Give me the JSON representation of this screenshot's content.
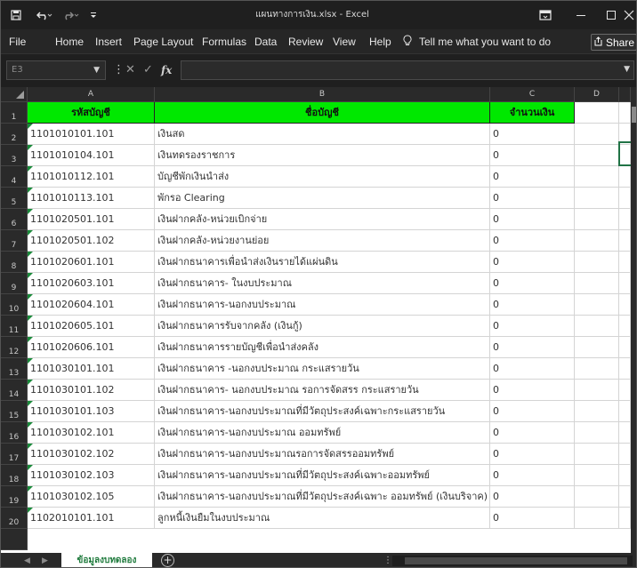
{
  "window": {
    "title": "แผนทางการเงิน.xlsx - Excel",
    "controls": [
      "minimize",
      "restore",
      "close"
    ]
  },
  "quick_access": {
    "save_icon": "save-icon",
    "undo_icon": "undo-icon",
    "redo_icon": "redo-icon"
  },
  "menu": {
    "items": [
      "File",
      "Home",
      "Insert",
      "Page Layout",
      "Formulas",
      "Data",
      "Review",
      "View",
      "Help"
    ],
    "tell_me": "Tell me what you want to do",
    "share": "Share"
  },
  "formula_bar": {
    "name_box": "E3",
    "fx": "fx",
    "value": ""
  },
  "columns": [
    "A",
    "B",
    "C",
    "D"
  ],
  "header_row": {
    "row_number": "1",
    "cells": [
      "รหัสบัญชี",
      "ชื่อบัญชี",
      "จำนวนเงิน"
    ]
  },
  "rows": [
    {
      "n": "2",
      "a": "1101010101.101",
      "b": "เงินสด",
      "c": "0"
    },
    {
      "n": "3",
      "a": "1101010104.101",
      "b": "เงินทดรองราชการ",
      "c": "0"
    },
    {
      "n": "4",
      "a": "1101010112.101",
      "b": "บัญชีพักเงินนำส่ง",
      "c": "0"
    },
    {
      "n": "5",
      "a": "1101010113.101",
      "b": "พักรอ Clearing",
      "c": "0"
    },
    {
      "n": "6",
      "a": "1101020501.101",
      "b": "เงินฝากคลัง-หน่วยเบิกจ่าย",
      "c": "0"
    },
    {
      "n": "7",
      "a": "1101020501.102",
      "b": "เงินฝากคลัง-หน่วยงานย่อย",
      "c": "0"
    },
    {
      "n": "8",
      "a": "1101020601.101",
      "b": "เงินฝากธนาคารเพื่อนำส่งเงินรายได้แผ่นดิน",
      "c": "0"
    },
    {
      "n": "9",
      "a": "1101020603.101",
      "b": "เงินฝากธนาคาร- ในงบประมาณ",
      "c": "0"
    },
    {
      "n": "10",
      "a": "1101020604.101",
      "b": "เงินฝากธนาคาร-นอกงบประมาณ",
      "c": "0"
    },
    {
      "n": "11",
      "a": "1101020605.101",
      "b": "เงินฝากธนาคารรับจากคลัง (เงินกู้)",
      "c": "0"
    },
    {
      "n": "12",
      "a": "1101020606.101",
      "b": "เงินฝากธนาคารรายบัญชีเพื่อนำส่งคลัง",
      "c": "0"
    },
    {
      "n": "13",
      "a": "1101030101.101",
      "b": "เงินฝากธนาคาร -นอกงบประมาณ กระแสรายวัน",
      "c": "0"
    },
    {
      "n": "14",
      "a": "1101030101.102",
      "b": "เงินฝากธนาคาร- นอกงบประมาณ รอการจัดสรร กระแสรายวัน",
      "c": "0"
    },
    {
      "n": "15",
      "a": "1101030101.103",
      "b": "เงินฝากธนาคาร-นอกงบประมาณที่มีวัตถุประสงค์เฉพาะกระแสรายวัน",
      "c": "0"
    },
    {
      "n": "16",
      "a": "1101030102.101",
      "b": "เงินฝากธนาคาร-นอกงบประมาณ ออมทรัพย์",
      "c": "0"
    },
    {
      "n": "17",
      "a": "1101030102.102",
      "b": "เงินฝากธนาคาร-นอกงบประมาณรอการจัดสรรออมทรัพย์",
      "c": "0"
    },
    {
      "n": "18",
      "a": "1101030102.103",
      "b": "เงินฝากธนาคาร-นอกงบประมาณที่มีวัตถุประสงค์เฉพาะออมทรัพย์",
      "c": "0"
    },
    {
      "n": "19",
      "a": "1101030102.105",
      "b": "เงินฝากธนาคาร-นอกงบประมาณที่มีวัตถุประสงค์เฉพาะ ออมทรัพย์ (เงินบริจาค)",
      "c": "0"
    },
    {
      "n": "20",
      "a": "1102010101.101",
      "b": "ลูกหนี้เงินยืมในงบประมาณ",
      "c": "0"
    }
  ],
  "sheets": {
    "active": "ข้อมูลงบทดลอง"
  },
  "colors": {
    "header_fill": "#00e800",
    "accent": "#217346",
    "chrome": "#1f1f1f"
  }
}
